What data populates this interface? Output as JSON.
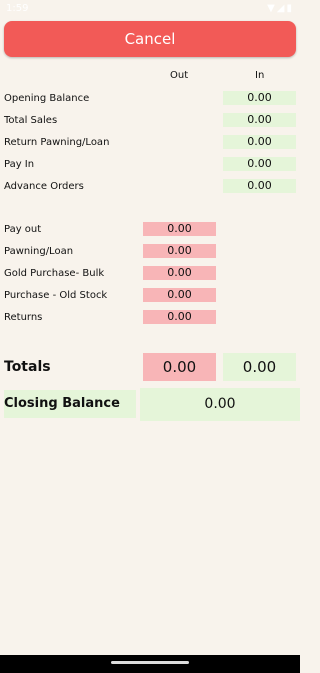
{
  "status": {
    "time": "1:59",
    "icons": "▼◢▮"
  },
  "cancel_label": "Cancel",
  "columns": {
    "out": "Out",
    "in": "In"
  },
  "in_rows": [
    {
      "label": "Opening Balance",
      "value": "0.00"
    },
    {
      "label": "Total Sales",
      "value": "0.00"
    },
    {
      "label": "Return Pawning/Loan",
      "value": "0.00"
    },
    {
      "label": "Pay In",
      "value": "0.00"
    },
    {
      "label": "Advance Orders",
      "value": "0.00"
    }
  ],
  "out_rows": [
    {
      "label": "Pay out",
      "value": "0.00"
    },
    {
      "label": "Pawning/Loan",
      "value": "0.00"
    },
    {
      "label": "Gold Purchase- Bulk",
      "value": "0.00"
    },
    {
      "label": "Purchase - Old Stock",
      "value": "0.00"
    },
    {
      "label": "Returns",
      "value": "0.00"
    }
  ],
  "totals": {
    "label": "Totals",
    "out": "0.00",
    "in": "0.00"
  },
  "closing": {
    "label": "Closing Balance",
    "value": "0.00"
  }
}
